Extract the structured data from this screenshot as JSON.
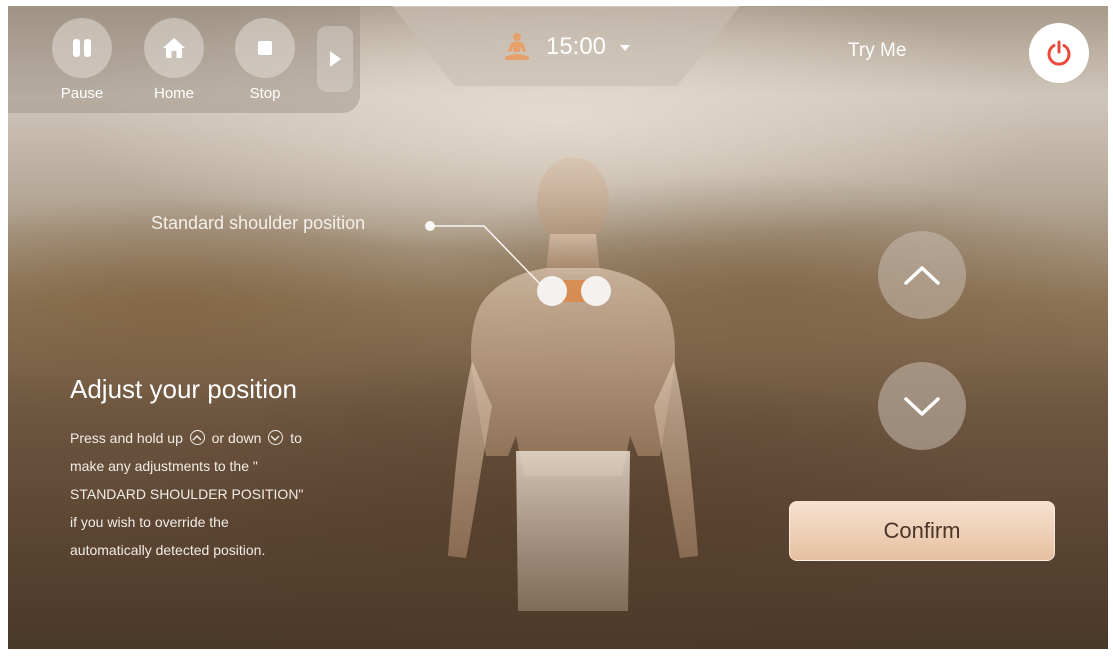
{
  "toolbar": {
    "pause_label": "Pause",
    "home_label": "Home",
    "stop_label": "Stop",
    "icons": {
      "pause": "pause-icon",
      "home": "home-icon",
      "stop": "stop-icon",
      "more": "play-arrow-icon"
    }
  },
  "timer": {
    "value": "15:00",
    "icon": "meditation-person-icon",
    "dropdown_icon": "caret-down-icon",
    "icon_color": "#e8a06a"
  },
  "header": {
    "try_me_label": "Try Me",
    "power_icon": "power-icon",
    "power_color": "#e84a3b"
  },
  "callout": {
    "label": "Standard shoulder position"
  },
  "instructions": {
    "title": "Adjust your position",
    "line1_a": "Press and hold up",
    "line1_b": "or down",
    "line1_c": "to",
    "line2": " make any adjustments to the \"",
    "line3": "STANDARD SHOULDER POSITION\"",
    "line4": "if you wish to override the",
    "line5": "automatically detected position."
  },
  "controls": {
    "up_icon": "chevron-up-icon",
    "down_icon": "chevron-down-icon",
    "confirm_label": "Confirm"
  },
  "colors": {
    "accent": "#e6c0a1",
    "shoulder_marker": "#d98a4e"
  }
}
